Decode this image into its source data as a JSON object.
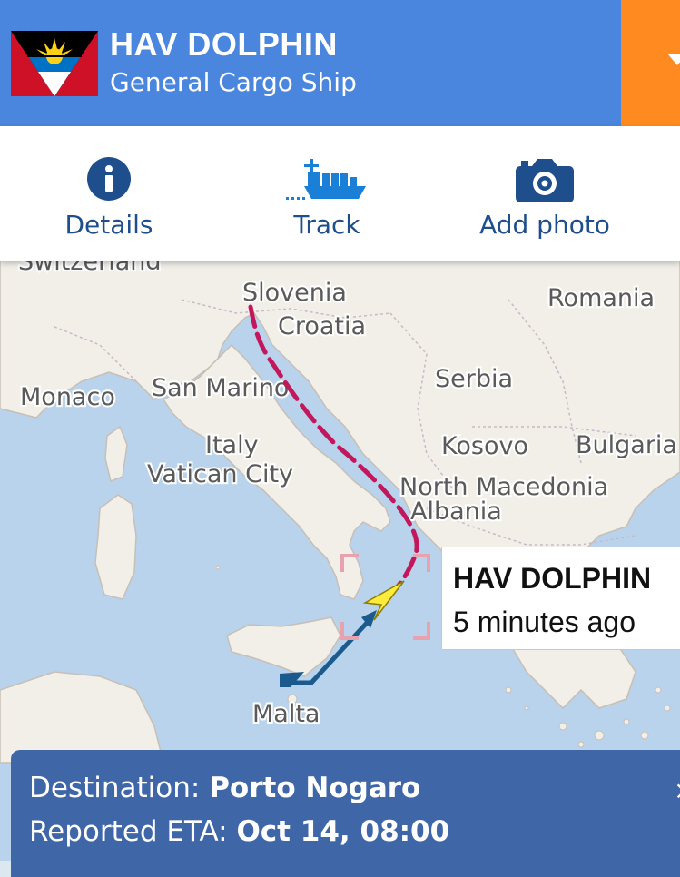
{
  "header": {
    "vessel_name": "HAV DOLPHIN",
    "vessel_type": "General Cargo Ship",
    "flag": "antigua-and-barbuda-flag",
    "accent_color": "#4a86dd",
    "action_color": "#ff8a1f"
  },
  "tabs": [
    {
      "label": "Details",
      "icon": "info-icon"
    },
    {
      "label": "Track",
      "icon": "ship-icon"
    },
    {
      "label": "Add photo",
      "icon": "camera-icon"
    }
  ],
  "map": {
    "countries": {
      "switzerland": "Switzerland",
      "slovenia": "Slovenia",
      "croatia": "Croatia",
      "romania": "Romania",
      "monaco": "Monaco",
      "san_marino": "San Marino",
      "serbia": "Serbia",
      "italy": "Italy",
      "vatican": "Vatican City",
      "kosovo": "Kosovo",
      "bulgaria": "Bulgaria",
      "north_macedonia": "North Macedonia",
      "albania": "Albania",
      "malta": "Malta"
    },
    "track_color": "#c2185b",
    "route_color": "#1a5a8c",
    "vessel_marker_color": "#ffeb3b"
  },
  "vessel_popup": {
    "name": "HAV DOLPHIN",
    "last_seen": "5 minutes ago"
  },
  "info_panel": {
    "destination_label": "Destination:",
    "destination": "Porto Nogaro",
    "eta_label": "Reported ETA:",
    "eta": "Oct 14, 08:00",
    "close_glyph": "×"
  }
}
